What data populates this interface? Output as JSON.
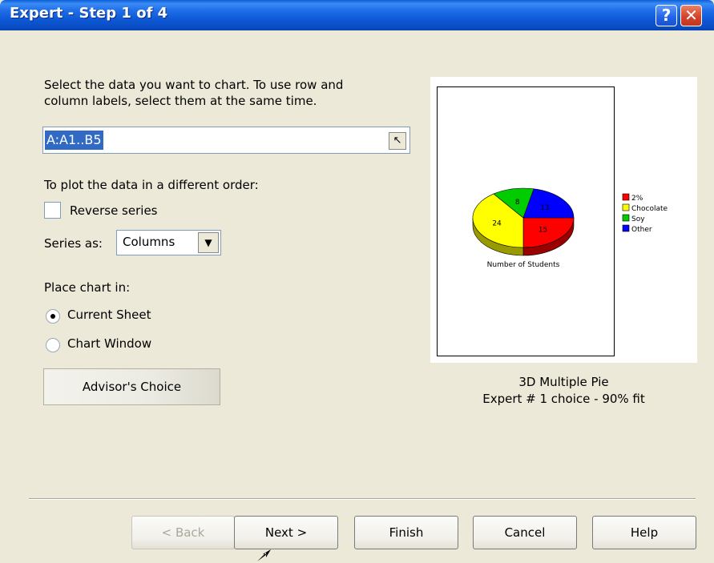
{
  "window": {
    "title": "Expert - Step 1 of 4"
  },
  "titlebar": {
    "help_glyph": "?",
    "close_glyph": "✕"
  },
  "instructions": {
    "line1": "Select the data you want to chart. To use row and",
    "line2": "column labels, select them at the same time."
  },
  "data_range": {
    "value": "A:A1..B5",
    "picker_icon": "cursor-pick-icon"
  },
  "order": {
    "heading": "To plot the data in a different order:",
    "reverse_label": "Reverse series",
    "reverse_checked": false
  },
  "series_as": {
    "label": "Series as:",
    "value": "Columns"
  },
  "place": {
    "heading": "Place chart in:",
    "options": [
      {
        "label": "Current Sheet",
        "checked": true
      },
      {
        "label": "Chart Window",
        "checked": false
      }
    ]
  },
  "advisor_button": "Advisor's Choice",
  "preview": {
    "chart_type": "3D Multiple Pie",
    "fit_text": "Expert # 1 choice - 90% fit"
  },
  "chart_data": {
    "type": "pie",
    "title": "Number of Students",
    "categories": [
      "2%",
      "Chocolate",
      "Soy",
      "Other"
    ],
    "values": [
      15,
      24,
      8,
      13
    ],
    "colors": [
      "#ff0000",
      "#ffff00",
      "#00cc00",
      "#0000ff"
    ],
    "legend_position": "right"
  },
  "buttons": {
    "back": "< Back",
    "next": "Next >",
    "finish": "Finish",
    "cancel": "Cancel",
    "help": "Help"
  }
}
